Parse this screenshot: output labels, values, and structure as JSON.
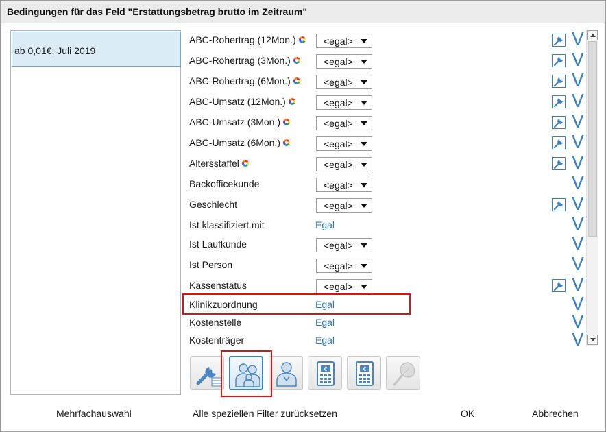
{
  "window": {
    "title": "Bedingungen für das Feld \"Erstattungsbetrag brutto im Zeitraum\""
  },
  "left_list": {
    "items": [
      {
        "label": "ab 0,01€; Juli 2019",
        "selected": true
      }
    ]
  },
  "conditions": [
    {
      "label": "ABC-Rohertrag (12Mon.)",
      "abc_icon": true,
      "control": "select",
      "value": "<egal>",
      "edit_icon": true,
      "v": "V"
    },
    {
      "label": "ABC-Rohertrag (3Mon.)",
      "abc_icon": true,
      "control": "select",
      "value": "<egal>",
      "edit_icon": true,
      "v": "V"
    },
    {
      "label": "ABC-Rohertrag (6Mon.)",
      "abc_icon": true,
      "control": "select",
      "value": "<egal>",
      "edit_icon": true,
      "v": "V"
    },
    {
      "label": "ABC-Umsatz (12Mon.)",
      "abc_icon": true,
      "control": "select",
      "value": "<egal>",
      "edit_icon": true,
      "v": "V"
    },
    {
      "label": "ABC-Umsatz (3Mon.)",
      "abc_icon": true,
      "control": "select",
      "value": "<egal>",
      "edit_icon": true,
      "v": "V"
    },
    {
      "label": "ABC-Umsatz (6Mon.)",
      "abc_icon": true,
      "control": "select",
      "value": "<egal>",
      "edit_icon": true,
      "v": "V"
    },
    {
      "label": "Altersstaffel",
      "abc_icon": true,
      "control": "select",
      "value": "<egal>",
      "edit_icon": true,
      "v": "V"
    },
    {
      "label": "Backofficekunde",
      "abc_icon": false,
      "control": "select",
      "value": "<egal>",
      "edit_icon": false,
      "v": "V"
    },
    {
      "label": "Geschlecht",
      "abc_icon": false,
      "control": "select",
      "value": "<egal>",
      "edit_icon": true,
      "v": "V"
    },
    {
      "label": "Ist klassifiziert mit",
      "abc_icon": false,
      "control": "link",
      "value": "Egal",
      "edit_icon": false,
      "v": "V"
    },
    {
      "label": "Ist Laufkunde",
      "abc_icon": false,
      "control": "select",
      "value": "<egal>",
      "edit_icon": false,
      "v": "V"
    },
    {
      "label": "Ist Person",
      "abc_icon": false,
      "control": "select",
      "value": "<egal>",
      "edit_icon": false,
      "v": "V"
    },
    {
      "label": "Kassenstatus",
      "abc_icon": false,
      "control": "select",
      "value": "<egal>",
      "edit_icon": true,
      "v": "V"
    },
    {
      "label": "Klinikzuordnung",
      "abc_icon": false,
      "control": "link",
      "value": "Egal",
      "edit_icon": false,
      "v": "V",
      "highlighted": true
    },
    {
      "label": "Kostenstelle",
      "abc_icon": false,
      "control": "link",
      "value": "Egal",
      "edit_icon": false,
      "v": "V"
    },
    {
      "label": "Kostenträger",
      "abc_icon": false,
      "control": "link",
      "value": "Egal",
      "edit_icon": false,
      "v": "V"
    }
  ],
  "toolbar": {
    "tools": [
      {
        "icon": "wrench-table-icon",
        "active": false
      },
      {
        "icon": "group-people-icon",
        "active": true,
        "highlighted": true
      },
      {
        "icon": "person-icon",
        "active": false
      },
      {
        "icon": "euro-calculator-icon",
        "active": false
      },
      {
        "icon": "euro-calculator-icon",
        "active": false
      },
      {
        "icon": "ginkgo-leaf-icon",
        "active": false,
        "disabled": true
      }
    ]
  },
  "footer": {
    "multi_select": "Mehrfachauswahl",
    "reset_filters": "Alle speziellen Filter zurücksetzen",
    "ok": "OK",
    "cancel": "Abbrechen"
  },
  "colors": {
    "accent": "#3b80c0",
    "link": "#2f79b3",
    "highlight_frame": "#e01010",
    "selection_bg": "#dcecf7"
  }
}
